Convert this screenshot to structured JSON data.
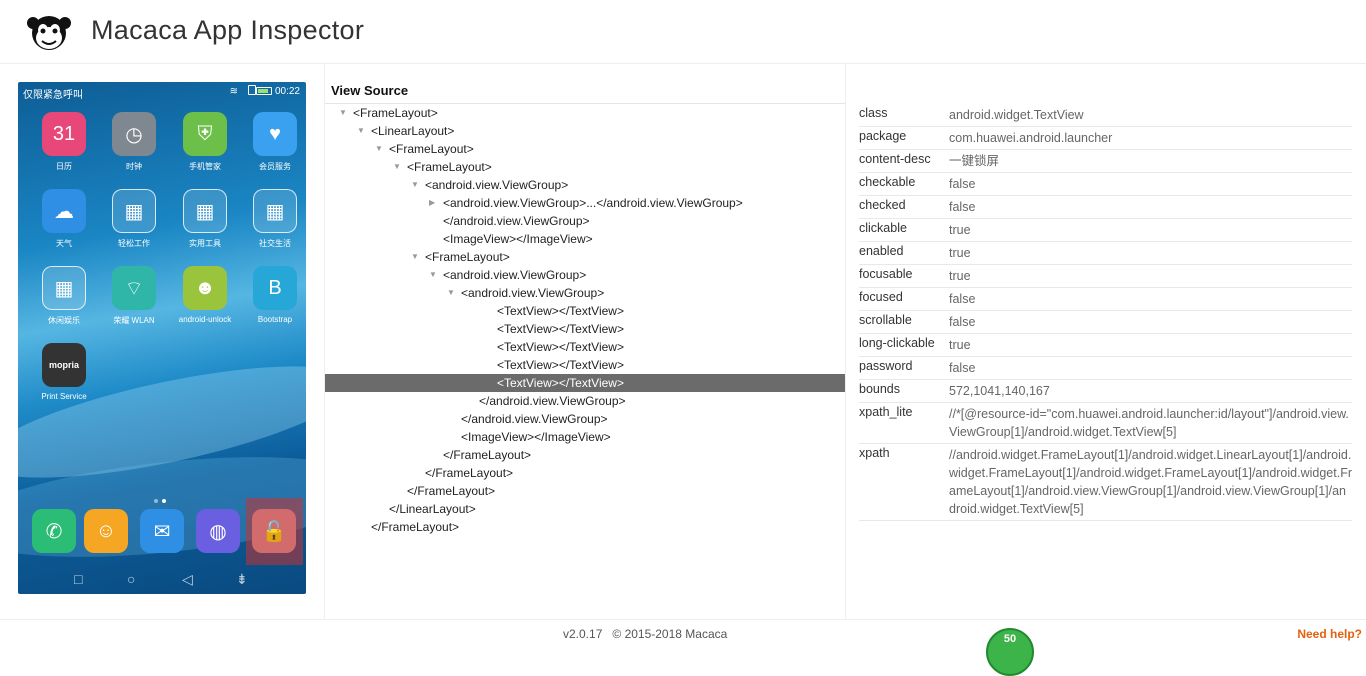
{
  "header": {
    "title": "Macaca App Inspector"
  },
  "phone": {
    "status_left": "仅限紧急呼叫",
    "time": "00:22",
    "apps": [
      {
        "label": "日历",
        "icon": "calendar-icon",
        "glyph": "31",
        "color": "#e8477a"
      },
      {
        "label": "时钟",
        "icon": "clock-icon",
        "glyph": "◷",
        "color": "#7f8790"
      },
      {
        "label": "手机管家",
        "icon": "shield-icon",
        "glyph": "⛨",
        "color": "#6cc04a"
      },
      {
        "label": "会员服务",
        "icon": "heart-icon",
        "glyph": "♥",
        "color": "#3aa0f0"
      },
      {
        "label": "天气",
        "icon": "cloud-icon",
        "glyph": "☁",
        "color": "#2f8fe5"
      },
      {
        "label": "轻松工作",
        "icon": "folder-icon",
        "glyph": "▦",
        "color": ""
      },
      {
        "label": "实用工具",
        "icon": "folder-icon",
        "glyph": "▦",
        "color": ""
      },
      {
        "label": "社交生活",
        "icon": "folder-icon",
        "glyph": "▦",
        "color": ""
      },
      {
        "label": "休闲娱乐",
        "icon": "folder-icon",
        "glyph": "▦",
        "color": ""
      },
      {
        "label": "荣耀 WLAN",
        "icon": "wifi-icon",
        "glyph": "⌔",
        "color": "#2fb6a8"
      },
      {
        "label": "android-unlock",
        "icon": "android-icon",
        "glyph": "☻",
        "color": "#9ac43c"
      },
      {
        "label": "Bootstrap",
        "icon": "bootstrap-icon",
        "glyph": "B",
        "color": "#26a7d8"
      },
      {
        "label": "Print Service",
        "icon": "mopria-icon",
        "glyph": "mopria",
        "color": "#333"
      }
    ],
    "dock": [
      {
        "icon": "phone-icon",
        "glyph": "✆",
        "color": "#2bbd75"
      },
      {
        "icon": "contacts-icon",
        "glyph": "☺",
        "color": "#f5a623"
      },
      {
        "icon": "message-icon",
        "glyph": "✉",
        "color": "#2f8fe5"
      },
      {
        "icon": "browser-icon",
        "glyph": "◍",
        "color": "#6a5fe0"
      },
      {
        "icon": "unlock-icon",
        "glyph": "🔓",
        "color": "#d26b6b"
      }
    ]
  },
  "tree": {
    "title": "View Source",
    "rows": [
      {
        "text": "<FrameLayout>",
        "indent": 0,
        "toggle": "open"
      },
      {
        "text": "<LinearLayout>",
        "indent": 1,
        "toggle": "open"
      },
      {
        "text": "<FrameLayout>",
        "indent": 2,
        "toggle": "open"
      },
      {
        "text": "<FrameLayout>",
        "indent": 3,
        "toggle": "open"
      },
      {
        "text": "<android.view.ViewGroup>",
        "indent": 4,
        "toggle": "open"
      },
      {
        "text": "<android.view.ViewGroup>...</android.view.ViewGroup>",
        "indent": 5,
        "toggle": "closed"
      },
      {
        "text": "</android.view.ViewGroup>",
        "indent": 5,
        "toggle": ""
      },
      {
        "text": "<ImageView></ImageView>",
        "indent": 5,
        "toggle": ""
      },
      {
        "text": "<FrameLayout>",
        "indent": 4,
        "toggle": "open"
      },
      {
        "text": "<android.view.ViewGroup>",
        "indent": 5,
        "toggle": "open"
      },
      {
        "text": "<android.view.ViewGroup>",
        "indent": 6,
        "toggle": "open"
      },
      {
        "text": "<TextView></TextView>",
        "indent": 8,
        "toggle": ""
      },
      {
        "text": "<TextView></TextView>",
        "indent": 8,
        "toggle": ""
      },
      {
        "text": "<TextView></TextView>",
        "indent": 8,
        "toggle": ""
      },
      {
        "text": "<TextView></TextView>",
        "indent": 8,
        "toggle": ""
      },
      {
        "text": "<TextView></TextView>",
        "indent": 8,
        "toggle": "",
        "selected": true
      },
      {
        "text": "</android.view.ViewGroup>",
        "indent": 7,
        "toggle": ""
      },
      {
        "text": "</android.view.ViewGroup>",
        "indent": 6,
        "toggle": ""
      },
      {
        "text": "<ImageView></ImageView>",
        "indent": 6,
        "toggle": ""
      },
      {
        "text": "</FrameLayout>",
        "indent": 5,
        "toggle": ""
      },
      {
        "text": "</FrameLayout>",
        "indent": 4,
        "toggle": ""
      },
      {
        "text": "</FrameLayout>",
        "indent": 3,
        "toggle": ""
      },
      {
        "text": "</LinearLayout>",
        "indent": 2,
        "toggle": ""
      },
      {
        "text": "</FrameLayout>",
        "indent": 1,
        "toggle": ""
      }
    ]
  },
  "props": [
    {
      "key": "class",
      "value": "android.widget.TextView"
    },
    {
      "key": "package",
      "value": "com.huawei.android.launcher"
    },
    {
      "key": "content-desc",
      "value": "一键锁屏"
    },
    {
      "key": "checkable",
      "value": "false"
    },
    {
      "key": "checked",
      "value": "false"
    },
    {
      "key": "clickable",
      "value": "true"
    },
    {
      "key": "enabled",
      "value": "true"
    },
    {
      "key": "focusable",
      "value": "true"
    },
    {
      "key": "focused",
      "value": "false"
    },
    {
      "key": "scrollable",
      "value": "false"
    },
    {
      "key": "long-clickable",
      "value": "true"
    },
    {
      "key": "password",
      "value": "false"
    },
    {
      "key": "bounds",
      "value": "572,1041,140,167"
    },
    {
      "key": "xpath_lite",
      "value": "//*[@resource-id=\"com.huawei.android.launcher:id/layout\"]/android.view.ViewGroup[1]/android.widget.TextView[5]"
    },
    {
      "key": "xpath",
      "value": "//android.widget.FrameLayout[1]/android.widget.LinearLayout[1]/android.widget.FrameLayout[1]/android.widget.FrameLayout[1]/android.widget.FrameLayout[1]/android.view.ViewGroup[1]/android.view.ViewGroup[1]/android.widget.TextView[5]"
    }
  ],
  "footer": {
    "version": "v2.0.17",
    "copyright": "© 2015-2018 Macaca",
    "help": "Need help?",
    "badge": "50"
  }
}
